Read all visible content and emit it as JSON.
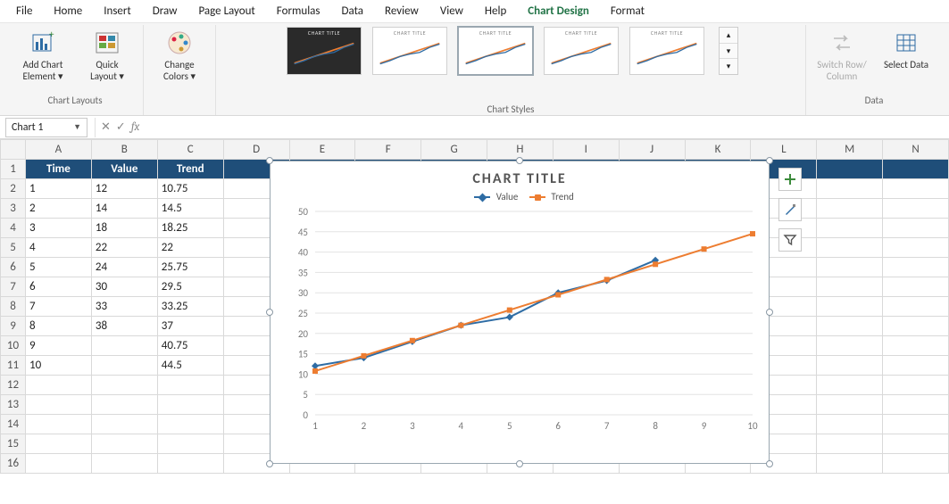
{
  "menu": {
    "items": [
      "File",
      "Home",
      "Insert",
      "Draw",
      "Page Layout",
      "Formulas",
      "Data",
      "Review",
      "View",
      "Help",
      "Chart Design",
      "Format"
    ],
    "active": "Chart Design"
  },
  "ribbon": {
    "chartLayouts": {
      "label": "Chart Layouts",
      "addChartElement": "Add Chart Element ▾",
      "quickLayout": "Quick Layout ▾"
    },
    "changeColors": "Change Colors ▾",
    "chartStyles": {
      "label": "Chart Styles"
    },
    "data": {
      "label": "Data",
      "switchRowColumn": "Switch Row/ Column",
      "selectData": "Select Data"
    }
  },
  "namebox": "Chart 1",
  "fx": {
    "cancel": "✕",
    "enter": "✓",
    "fx": "fx"
  },
  "columns": [
    "A",
    "B",
    "C",
    "D",
    "E",
    "F",
    "G",
    "H",
    "I",
    "J",
    "K",
    "L",
    "M",
    "N"
  ],
  "rowcount": 16,
  "table": {
    "header": [
      "Time",
      "Value",
      "Trend"
    ],
    "rows": [
      [
        "1",
        "12",
        "10.75"
      ],
      [
        "2",
        "14",
        "14.5"
      ],
      [
        "3",
        "18",
        "18.25"
      ],
      [
        "4",
        "22",
        "22"
      ],
      [
        "5",
        "24",
        "25.75"
      ],
      [
        "6",
        "30",
        "29.5"
      ],
      [
        "7",
        "33",
        "33.25"
      ],
      [
        "8",
        "38",
        "37"
      ],
      [
        "9",
        "",
        "40.75"
      ],
      [
        "10",
        "",
        "44.5"
      ]
    ]
  },
  "chart_data": {
    "type": "line",
    "title": "CHART TITLE",
    "categories": [
      1,
      2,
      3,
      4,
      5,
      6,
      7,
      8,
      9,
      10
    ],
    "series": [
      {
        "name": "Value",
        "color": "#2e6ca4",
        "values": [
          12,
          14,
          18,
          22,
          24,
          30,
          33,
          38,
          null,
          null
        ]
      },
      {
        "name": "Trend",
        "color": "#ed7d31",
        "values": [
          10.75,
          14.5,
          18.25,
          22,
          25.75,
          29.5,
          33.25,
          37,
          40.75,
          44.5
        ]
      }
    ],
    "ylabel": "",
    "xlabel": "",
    "ylim": [
      0,
      50
    ],
    "ytick": 5
  },
  "sidebuttons": [
    "plus-icon",
    "brush-icon",
    "funnel-icon"
  ]
}
